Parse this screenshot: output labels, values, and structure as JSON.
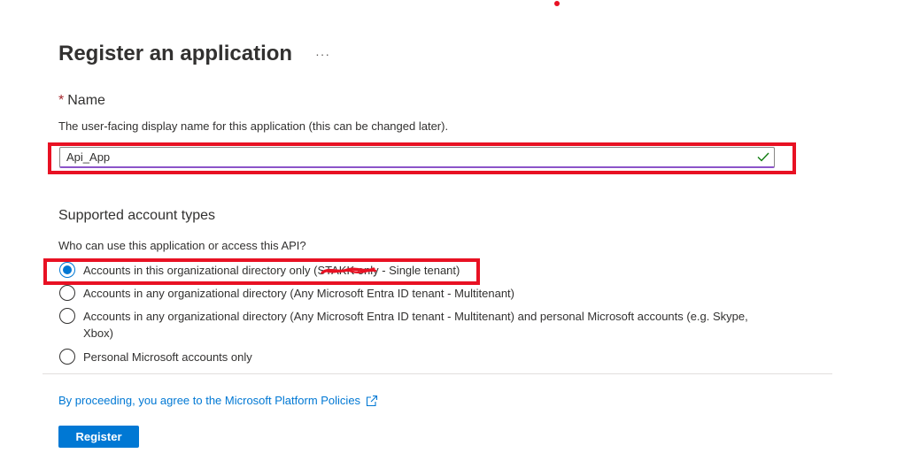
{
  "header": {
    "title": "Register an application",
    "more_label": "···"
  },
  "name_section": {
    "required_marker": "*",
    "label": "Name",
    "description": "The user-facing display name for this application (this can be changed later).",
    "input_value": "Api_App",
    "valid_icon": "checkmark-icon"
  },
  "account_types": {
    "title": "Supported account types",
    "question": "Who can use this application or access this API?",
    "options": [
      {
        "label": "Accounts in this organizational directory only (STAKK only - Single tenant)",
        "selected": true
      },
      {
        "label": "Accounts in any organizational directory (Any Microsoft Entra ID tenant - Multitenant)",
        "selected": false
      },
      {
        "label": "Accounts in any organizational directory (Any Microsoft Entra ID tenant - Multitenant) and personal Microsoft accounts (e.g. Skype, Xbox)",
        "selected": false
      },
      {
        "label": "Personal Microsoft accounts only",
        "selected": false
      }
    ]
  },
  "footer": {
    "policy_text": "By proceeding, you agree to the Microsoft Platform Policies",
    "policy_icon": "external-link-icon",
    "register_label": "Register"
  },
  "colors": {
    "accent": "#0078d4",
    "annotation_red": "#e81123",
    "valid_green": "#107c10"
  }
}
